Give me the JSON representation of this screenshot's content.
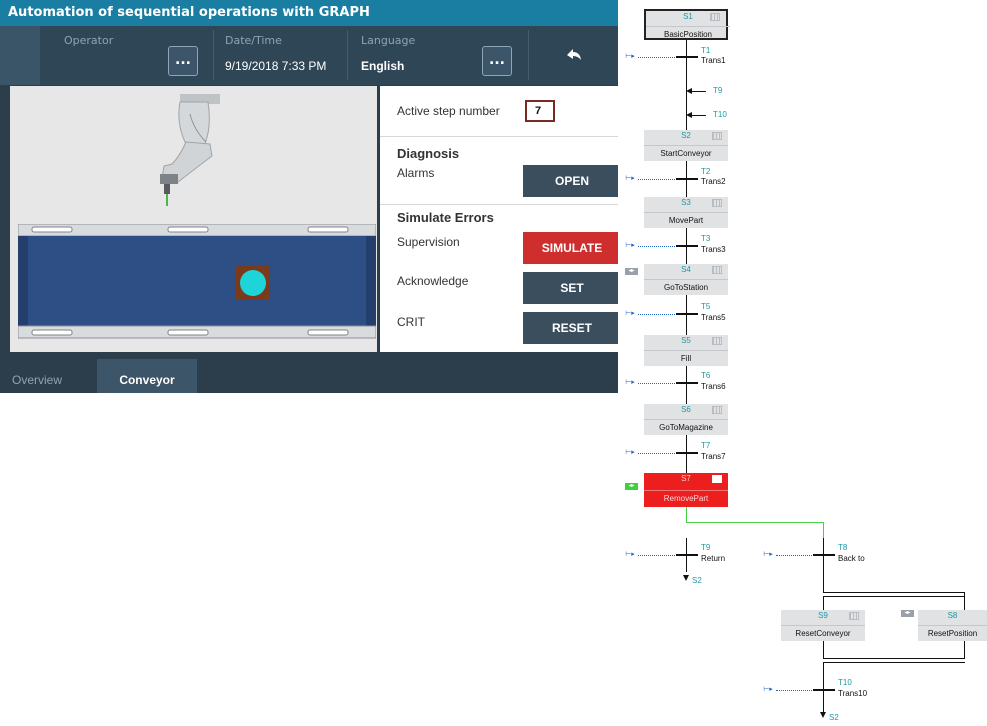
{
  "title": "Automation of sequential operations with GRAPH",
  "header": {
    "operator_label": "Operator",
    "operator_value": "",
    "datetime_label": "Date/Time",
    "datetime_value": "9/19/2018 7:33 PM",
    "language_label": "Language",
    "language_value": "English",
    "more_button": "..."
  },
  "panel": {
    "active_step_label": "Active step number",
    "active_step_value": "7",
    "diagnosis_heading": "Diagnosis",
    "alarms_label": "Alarms",
    "open_button": "OPEN",
    "simulate_heading": "Simulate Errors",
    "supervision_label": "Supervision",
    "simulate_button": "SIMULATE",
    "acknowledge_label": "Acknowledge",
    "set_button": "SET",
    "crit_label": "CRIT",
    "reset_button": "RESET"
  },
  "tabs": {
    "overview": "Overview",
    "conveyor": "Conveyor"
  },
  "colors": {
    "title_bar": "#1a7ea3",
    "active_step": "#ec1e1e",
    "simulate_button": "#cf2e2e",
    "conveyor_belt": "#2e4f86",
    "part": "#1fd4d8"
  },
  "graph": {
    "steps": [
      {
        "id": "S1",
        "name": "BasicPosition",
        "initial": true
      },
      {
        "id": "S2",
        "name": "StartConveyor"
      },
      {
        "id": "S3",
        "name": "MovePart"
      },
      {
        "id": "S4",
        "name": "GoToStation"
      },
      {
        "id": "S5",
        "name": "Fill"
      },
      {
        "id": "S6",
        "name": "GoToMagazine"
      },
      {
        "id": "S7",
        "name": "RemovePart",
        "active": true
      },
      {
        "id": "S9",
        "name": "ResetConveyor"
      },
      {
        "id": "S8",
        "name": "ResetPosition"
      }
    ],
    "transitions": [
      {
        "id": "T1",
        "name": "Trans1"
      },
      {
        "id": "T2",
        "name": "Trans2"
      },
      {
        "id": "T3",
        "name": "Trans3"
      },
      {
        "id": "T5",
        "name": "Trans5"
      },
      {
        "id": "T6",
        "name": "Trans6"
      },
      {
        "id": "T7",
        "name": "Trans7"
      },
      {
        "id": "T9",
        "name": "Return"
      },
      {
        "id": "T8",
        "name": "Back to"
      },
      {
        "id": "T10",
        "name": "Trans10"
      }
    ],
    "incoming_jumps": [
      "T9",
      "T10"
    ],
    "jump_targets": [
      "S2",
      "S2"
    ]
  }
}
